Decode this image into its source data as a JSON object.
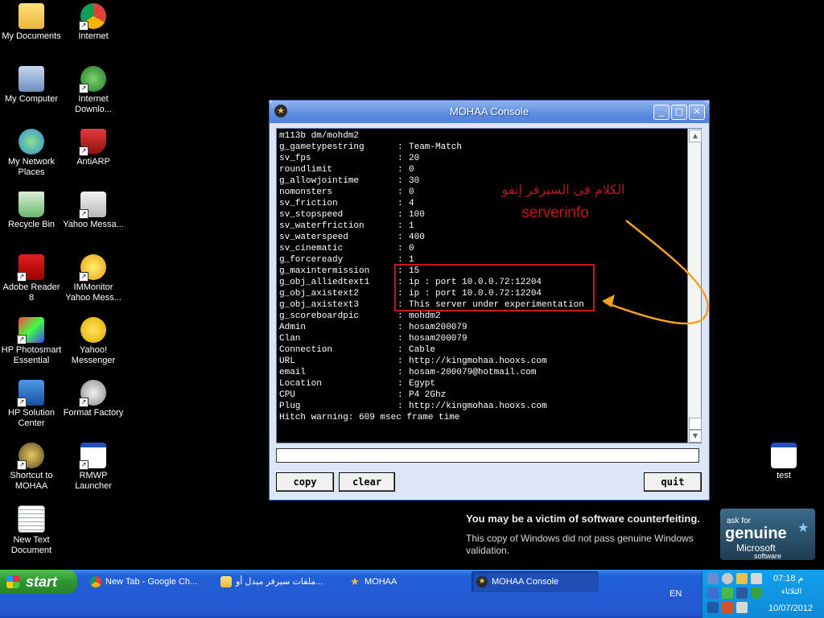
{
  "desktop": {
    "icons": [
      {
        "label": "My Documents",
        "icon": "folder-icon"
      },
      {
        "label": "Internet",
        "icon": "chrome-icon"
      },
      {
        "label": "My Computer",
        "icon": "computer-icon"
      },
      {
        "label": "Internet Downlo...",
        "icon": "download-manager-icon"
      },
      {
        "label": "My Network Places",
        "icon": "network-icon"
      },
      {
        "label": "AntiARP",
        "icon": "shield-icon"
      },
      {
        "label": "Recycle Bin",
        "icon": "recycle-bin-icon"
      },
      {
        "label": "Yahoo Messa...",
        "icon": "yahoo-messenger-icon"
      },
      {
        "label": "Adobe Reader 8",
        "icon": "pdf-icon"
      },
      {
        "label": "IMMonitor Yahoo Mess...",
        "icon": "immonitor-icon"
      },
      {
        "label": "HP Photosmart Essential",
        "icon": "photosmart-icon"
      },
      {
        "label": "Yahoo! Messenger",
        "icon": "yahoo-smiley-icon"
      },
      {
        "label": "HP Solution Center",
        "icon": "hp-icon"
      },
      {
        "label": "Format Factory",
        "icon": "format-factory-icon"
      },
      {
        "label": "Shortcut to MOHAA",
        "icon": "mohaa-star-icon"
      },
      {
        "label": "RMWP Launcher",
        "icon": "window-icon"
      },
      {
        "label": "New Text Document",
        "icon": "text-document-icon"
      },
      {
        "label": "test",
        "icon": "test-app-icon"
      }
    ]
  },
  "console": {
    "title": "MOHAA Console",
    "header_line": "m113b dm/mohdm2",
    "separator": ":",
    "lines": [
      {
        "key": "g_gametypestring",
        "value": "Team-Match"
      },
      {
        "key": "sv_fps",
        "value": "20"
      },
      {
        "key": "roundlimit",
        "value": "0"
      },
      {
        "key": "g_allowjointime",
        "value": "30"
      },
      {
        "key": "nomonsters",
        "value": "0"
      },
      {
        "key": "sv_friction",
        "value": "4"
      },
      {
        "key": "sv_stopspeed",
        "value": "100"
      },
      {
        "key": "sv_waterfriction",
        "value": "1"
      },
      {
        "key": "sv_waterspeed",
        "value": "400"
      },
      {
        "key": "sv_cinematic",
        "value": "0"
      },
      {
        "key": "g_forceready",
        "value": "1"
      },
      {
        "key": "g_maxintermission",
        "value": "15"
      },
      {
        "key": "g_obj_alliedtext1",
        "value": "ip : port 10.0.0.72:12204"
      },
      {
        "key": "g_obj_axistext2",
        "value": "ip : port 10.0.0.72:12204"
      },
      {
        "key": "g_obj_axistext3",
        "value": "This server under experimentation"
      },
      {
        "key": "g_scoreboardpic",
        "value": "mohdm2"
      },
      {
        "key": "Admin",
        "value": "hosam200079"
      },
      {
        "key": "Clan",
        "value": "hosam200079"
      },
      {
        "key": "Connection",
        "value": "Cable"
      },
      {
        "key": "URL",
        "value": "http://kingmohaa.hooxs.com"
      },
      {
        "key": "email",
        "value": "hosam-200079@hotmail.com"
      },
      {
        "key": "Location",
        "value": "Egypt"
      },
      {
        "key": "CPU",
        "value": "P4 2Ghz"
      },
      {
        "key": "Plug",
        "value": "http://kingmohaa.hooxs.com"
      }
    ],
    "footer_line": "Hitch warning: 609 msec frame time",
    "input_value": "",
    "buttons": {
      "copy": "copy",
      "clear": "clear",
      "quit": "quit"
    }
  },
  "annotation": {
    "arabic_text": "الكلام فى السيرفر إنفو",
    "english_text": "serverinfo",
    "color": "#c9141d",
    "arrow_color": "#f5a020"
  },
  "genuine": {
    "title": "You may be a victim of software counterfeiting.",
    "body": "This copy of Windows did not pass genuine Windows validation.",
    "badge_top": "ask for",
    "badge_main": "genuine",
    "badge_brand": "Microsoft",
    "badge_sub": "software"
  },
  "taskbar": {
    "start_label": "start",
    "items": [
      {
        "label": "New Tab - Google Ch...",
        "icon": "chrome-icon"
      },
      {
        "label": "ملفات سيرفر ميدل أو...",
        "icon": "folder-icon"
      },
      {
        "label": "MOHAA",
        "icon": "mohaa-star-icon"
      },
      {
        "label": "MOHAA Console",
        "icon": "mohaa-console-icon"
      }
    ],
    "language": "EN",
    "time": "م 07:18",
    "day": "الثلاثاء",
    "date": "10/07/2012"
  }
}
